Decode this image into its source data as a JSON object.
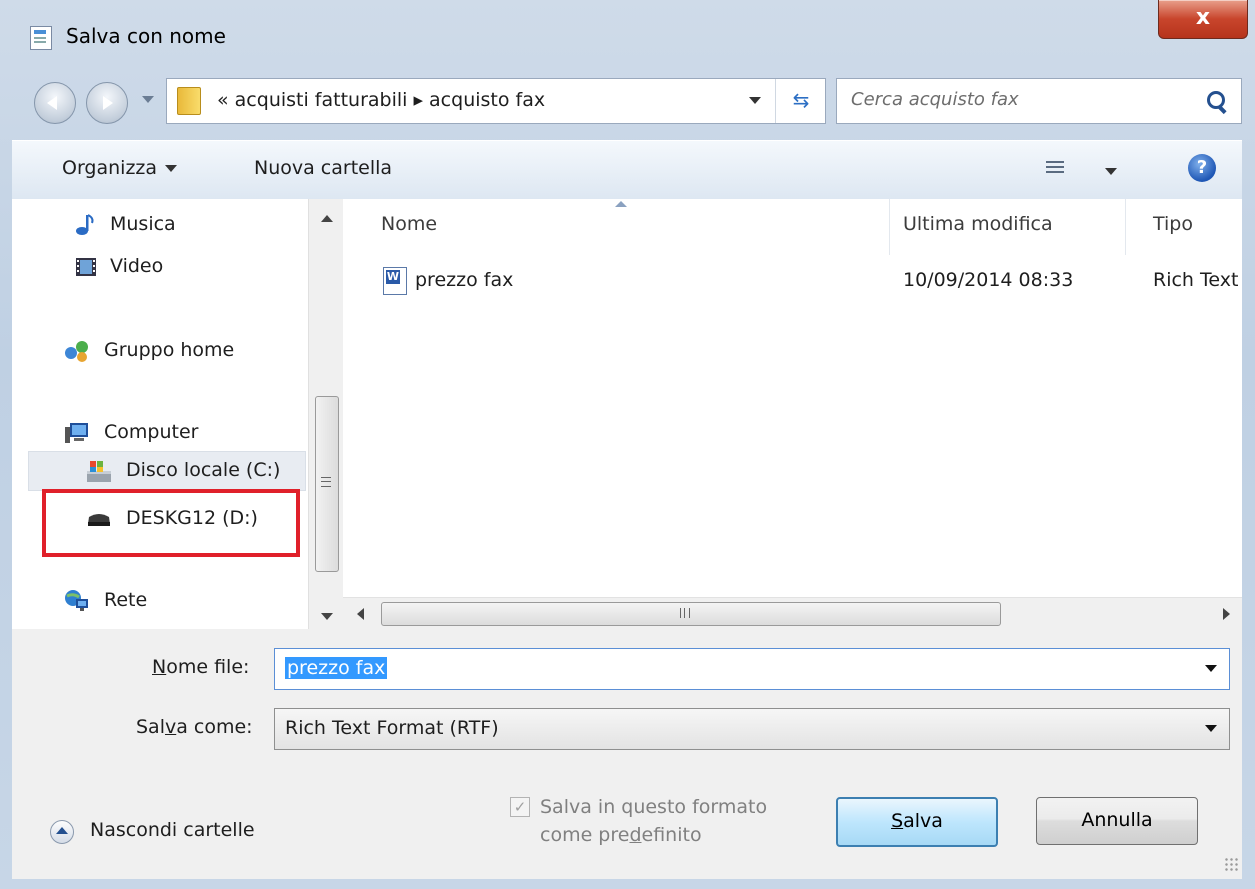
{
  "window": {
    "title": "Salva con nome",
    "close_label": "x"
  },
  "address_bar": {
    "path": "« acquisti fatturabili ▸ acquisto fax"
  },
  "search": {
    "placeholder": "Cerca acquisto fax"
  },
  "toolbar": {
    "organize_label": "Organizza",
    "new_folder_label": "Nuova cartella",
    "help_label": "?"
  },
  "nav_pane": {
    "items": [
      {
        "label": "Musica",
        "icon": "music-icon"
      },
      {
        "label": "Video",
        "icon": "video-icon"
      },
      {
        "label": "Gruppo home",
        "icon": "homegroup-icon"
      },
      {
        "label": "Computer",
        "icon": "computer-icon"
      },
      {
        "label": "Disco locale (C:)",
        "icon": "local-disk-icon"
      },
      {
        "label": "DESKG12 (D:)",
        "icon": "drive-icon"
      },
      {
        "label": "Rete",
        "icon": "network-icon"
      }
    ],
    "highlight_color": "#e0202a"
  },
  "file_list": {
    "columns": [
      "Nome",
      "Ultima modifica",
      "Tipo"
    ],
    "rows": [
      {
        "name": "prezzo fax",
        "modified": "10/09/2014 08:33",
        "type": "Rich Text"
      }
    ]
  },
  "form": {
    "filename_label_underlined": "N",
    "filename_label_rest": "ome file:",
    "filename_value": "prezzo fax",
    "savetype_label_pre": "Sal",
    "savetype_label_underlined": "v",
    "savetype_label_post": "a come:",
    "savetype_value": "Rich Text Format (RTF)"
  },
  "footer": {
    "hide_folders_label": "Nascondi cartelle",
    "default_format_line1": "Salva in questo formato",
    "default_format_line2_pre": "come pre",
    "default_format_line2_underlined": "d",
    "default_format_line2_post": "efinito",
    "save_label_underlined": "S",
    "save_label_rest": "alva",
    "cancel_label": "Annulla"
  }
}
